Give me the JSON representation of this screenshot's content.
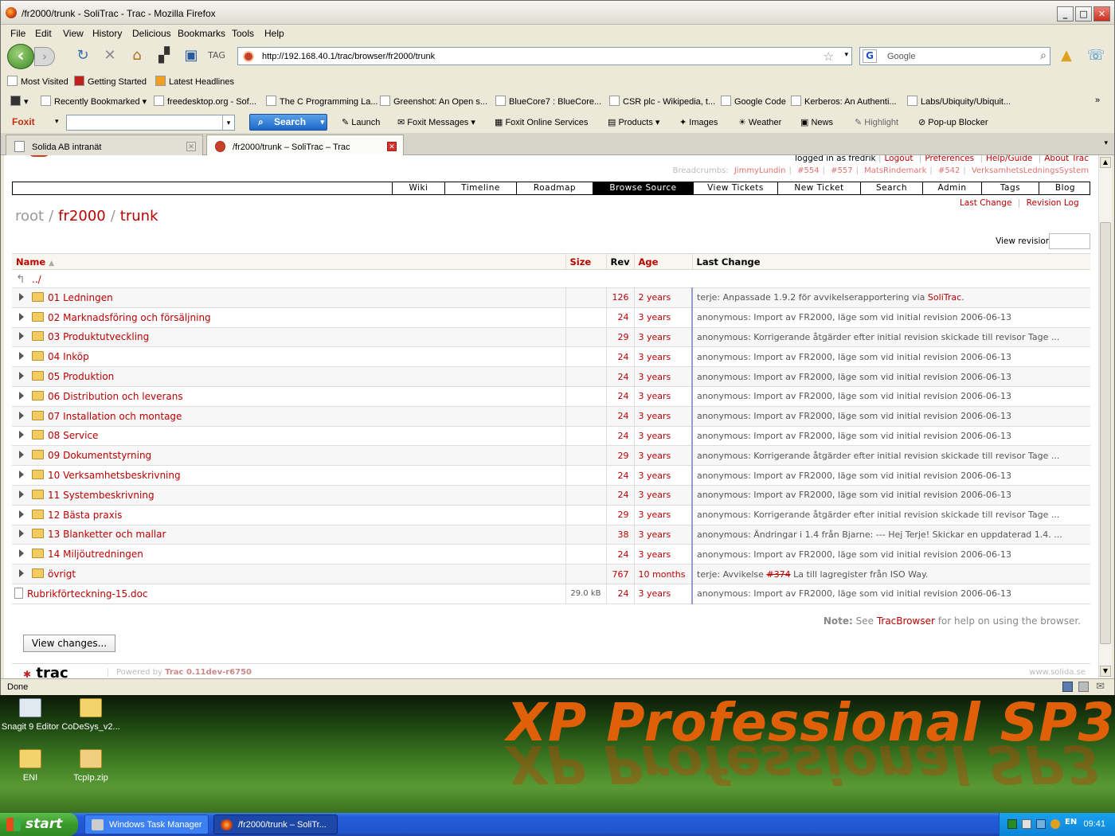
{
  "window": {
    "title": "/fr2000/trunk - SoliTrac - Trac - Mozilla Firefox"
  },
  "menu": [
    "File",
    "Edit",
    "View",
    "History",
    "Delicious",
    "Bookmarks",
    "Tools",
    "Help"
  ],
  "address": {
    "url": "http://192.168.40.1/trac/browser/fr2000/trunk"
  },
  "search": {
    "placeholder": "Google",
    "engine": "G"
  },
  "bookmarks": [
    "Most Visited",
    "Getting Started",
    "Latest Headlines"
  ],
  "delicious": [
    "Recently Bookmarked",
    "freedesktop.org - Sof...",
    "The C Programming La...",
    "Greenshot: An Open s...",
    "BlueCore7 : BlueCore...",
    "CSR plc - Wikipedia, t...",
    "Google Code",
    "Kerberos: An Authenti...",
    "Labs/Ubiquity/Ubiquit..."
  ],
  "foxit": {
    "logo": "Foxit",
    "search_label": "Search",
    "items": [
      "Launch",
      "Foxit Messages",
      "Foxit Online Services",
      "Products",
      "Images",
      "Weather",
      "News",
      "Highlight",
      "Pop-up Blocker"
    ]
  },
  "tabs": [
    {
      "label": "Solida AB intranät"
    },
    {
      "label": "/fr2000/trunk – SoliTrac – Trac"
    }
  ],
  "trac": {
    "meta": [
      "logged in as fredrik",
      "Logout",
      "Preferences",
      "Help/Guide",
      "About Trac"
    ],
    "breadcrumbs_label": "Breadcrumbs:",
    "breadcrumbs": [
      "JimmyLundin",
      "#554",
      "#557",
      "MatsRindemark",
      "#542",
      "VerksamhetsLedningsSystem"
    ],
    "nav": [
      "Wiki",
      "Timeline",
      "Roadmap",
      "Browse Source",
      "View Tickets",
      "New Ticket",
      "Search",
      "Admin",
      "Tags",
      "Blog"
    ],
    "ctxnav": [
      "Last Change",
      "Revision Log"
    ],
    "path": {
      "root": "root",
      "p1": "fr2000",
      "p2": "trunk",
      "sep": "/"
    },
    "view_revision": "View revision:",
    "columns": [
      "Name",
      "Size",
      "Rev",
      "Age",
      "Last Change"
    ],
    "sort_indicator": "▲",
    "parent": "../",
    "rows": [
      {
        "name": "01 Ledningen",
        "size": "",
        "rev": "126",
        "age": "2 years",
        "chg": "terje: Anpassade 1.9.2 för avvikelserapportering via ",
        "link": "SoliTrac",
        "tail": "."
      },
      {
        "name": "02 Marknadsföring och försäljning",
        "size": "",
        "rev": "24",
        "age": "3 years",
        "chg": "anonymous: Import av FR2000, läge som vid initial revision 2006-06-13",
        "link": "",
        "tail": ""
      },
      {
        "name": "03 Produktutveckling",
        "size": "",
        "rev": "29",
        "age": "3 years",
        "chg": "anonymous: Korrigerande åtgärder efter initial revision skickade till revisor Tage ...",
        "link": "",
        "tail": ""
      },
      {
        "name": "04 Inköp",
        "size": "",
        "rev": "24",
        "age": "3 years",
        "chg": "anonymous: Import av FR2000, läge som vid initial revision 2006-06-13",
        "link": "",
        "tail": ""
      },
      {
        "name": "05 Produktion",
        "size": "",
        "rev": "24",
        "age": "3 years",
        "chg": "anonymous: Import av FR2000, läge som vid initial revision 2006-06-13",
        "link": "",
        "tail": ""
      },
      {
        "name": "06 Distribution och leverans",
        "size": "",
        "rev": "24",
        "age": "3 years",
        "chg": "anonymous: Import av FR2000, läge som vid initial revision 2006-06-13",
        "link": "",
        "tail": ""
      },
      {
        "name": "07 Installation och montage",
        "size": "",
        "rev": "24",
        "age": "3 years",
        "chg": "anonymous: Import av FR2000, läge som vid initial revision 2006-06-13",
        "link": "",
        "tail": ""
      },
      {
        "name": "08 Service",
        "size": "",
        "rev": "24",
        "age": "3 years",
        "chg": "anonymous: Import av FR2000, läge som vid initial revision 2006-06-13",
        "link": "",
        "tail": ""
      },
      {
        "name": "09 Dokumentstyrning",
        "size": "",
        "rev": "29",
        "age": "3 years",
        "chg": "anonymous: Korrigerande åtgärder efter initial revision skickade till revisor Tage ...",
        "link": "",
        "tail": ""
      },
      {
        "name": "10 Verksamhetsbeskrivning",
        "size": "",
        "rev": "24",
        "age": "3 years",
        "chg": "anonymous: Import av FR2000, läge som vid initial revision 2006-06-13",
        "link": "",
        "tail": ""
      },
      {
        "name": "11 Systembeskrivning",
        "size": "",
        "rev": "24",
        "age": "3 years",
        "chg": "anonymous: Import av FR2000, läge som vid initial revision 2006-06-13",
        "link": "",
        "tail": ""
      },
      {
        "name": "12 Bästa praxis",
        "size": "",
        "rev": "29",
        "age": "3 years",
        "chg": "anonymous: Korrigerande åtgärder efter initial revision skickade till revisor Tage ...",
        "link": "",
        "tail": ""
      },
      {
        "name": "13 Blanketter och mallar",
        "size": "",
        "rev": "38",
        "age": "3 years",
        "chg": "anonymous: Ändringar i 1.4 från Bjarne: --- Hej Terje! Skickar en uppdaterad 1.4. ...",
        "link": "",
        "tail": ""
      },
      {
        "name": "14 Miljöutredningen",
        "size": "",
        "rev": "24",
        "age": "3 years",
        "chg": "anonymous: Import av FR2000, läge som vid initial revision 2006-06-13",
        "link": "",
        "tail": ""
      },
      {
        "name": "övrigt",
        "size": "",
        "rev": "767",
        "age": "10 months",
        "chg": "terje: Avvikelse ",
        "link": "#374",
        "tail": " La till lagregister från ISO Way."
      },
      {
        "name": "Rubrikförteckning-15.doc",
        "size": "29.0 kB",
        "rev": "24",
        "age": "3 years",
        "chg": "anonymous: Import av FR2000, läge som vid initial revision 2006-06-13",
        "link": "",
        "tail": "",
        "file": true
      }
    ],
    "note_label": "Note:",
    "note_pre": " See ",
    "note_link": "TracBrowser",
    "note_post": " for help on using the browser.",
    "view_changes": "View changes...",
    "footer_logo": "trac",
    "powered": "Powered by ",
    "powered_link": "Trac 0.11dev-r6750",
    "site": "www.solida.se"
  },
  "status": "Done",
  "desktop": {
    "watermark": "XP Professional SP3",
    "icons": [
      "Snagit 9 Editor",
      "CoDeSys_v2...",
      "ENI",
      "TcpIp.zip"
    ]
  },
  "taskbar": {
    "start": "start",
    "tasks": [
      "Windows Task Manager",
      "/fr2000/trunk – SoliTr..."
    ],
    "clock": "09:41"
  }
}
